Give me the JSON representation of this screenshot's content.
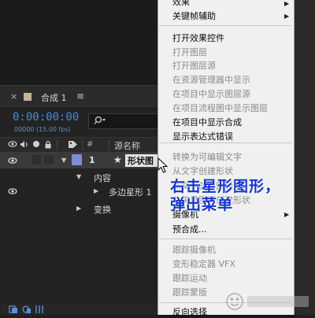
{
  "composition_panel": {
    "tab_name": "合成 1",
    "tab_menu_icon": "≡",
    "close_icon": "×",
    "timecode": "0:00:00:00",
    "fps_label": "00000 (15.00 fps)",
    "search_placeholder": "",
    "columns": {
      "number": "#",
      "name": "源名称"
    },
    "layer": {
      "number": "1",
      "name": "形状图"
    },
    "tree": {
      "contents_label": "内容",
      "polystar_label": "多边星形 1",
      "transform_label": "变换"
    }
  },
  "context_menu": {
    "items": [
      {
        "label": "效果",
        "disabled": false,
        "submenu": true
      },
      {
        "label": "关键帧辅助",
        "disabled": false,
        "submenu": true
      },
      {
        "label": "打开效果控件",
        "disabled": false
      },
      {
        "label": "打开图层",
        "disabled": true
      },
      {
        "label": "打开图层源",
        "disabled": true
      },
      {
        "label": "在资源管理器中显示",
        "disabled": true
      },
      {
        "label": "在项目中显示图层源",
        "disabled": true
      },
      {
        "label": "在项目流程图中显示图层",
        "disabled": true
      },
      {
        "label": "在项目中显示合成",
        "disabled": false
      },
      {
        "label": "显示表达式错误",
        "disabled": false
      },
      {
        "label": "转换为可编辑文字",
        "disabled": true
      },
      {
        "label": "从文字创建形状",
        "disabled": true
      },
      {
        "label": "从文字创建蒙版",
        "disabled": true
      },
      {
        "label": "从矢量图层创建形状",
        "disabled": true
      },
      {
        "label": "摄像机",
        "disabled": false,
        "submenu": true
      },
      {
        "label": "预合成...",
        "disabled": false
      },
      {
        "label": "跟踪摄像机",
        "disabled": true
      },
      {
        "label": "变形稳定器 VFX",
        "disabled": true
      },
      {
        "label": "跟踪运动",
        "disabled": true
      },
      {
        "label": "跟踪蒙版",
        "disabled": true
      },
      {
        "label": "反向选择",
        "disabled": false
      }
    ]
  },
  "annotation": {
    "line1": "右击星形图形，",
    "line2": "弹出菜单"
  },
  "colors": {
    "timecode": "#3d8fe0",
    "layer_label": "#7a8fd6",
    "annotation": "#1233d6",
    "menu_bg": "#f0f0f0"
  }
}
